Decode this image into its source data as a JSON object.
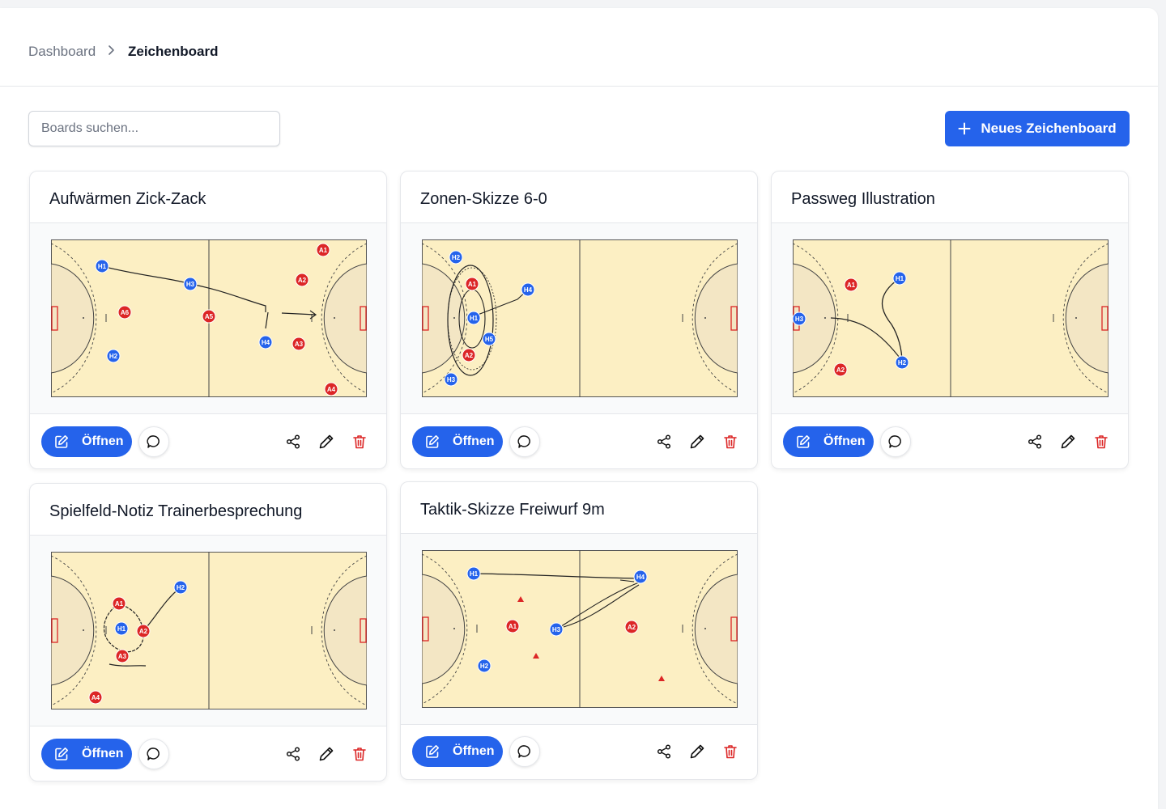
{
  "breadcrumb": {
    "home": "Dashboard",
    "current": "Zeichenboard"
  },
  "search": {
    "placeholder": "Boards suchen..."
  },
  "toolbar": {
    "new_board_label": "Neues Zeichenboard"
  },
  "colors": {
    "accent": "#2563eb",
    "danger": "#dc2626",
    "court": "#fcefc3",
    "team_h": "#2563eb",
    "team_a": "#dc2626"
  },
  "card_actions": {
    "open_label": "Öffnen",
    "comment_icon": "chat-bubble-icon",
    "share_icon": "share-icon",
    "edit_icon": "pencil-icon",
    "delete_icon": "trash-icon"
  },
  "boards": [
    {
      "title": "Aufwärmen Zick-Zack",
      "players": [
        "H1",
        "H2",
        "H3",
        "H4",
        "A1",
        "A2",
        "A3",
        "A4",
        "A5",
        "A6"
      ]
    },
    {
      "title": "Zonen-Skizze 6-0",
      "players": [
        "H1",
        "H2",
        "H3",
        "H4",
        "H5",
        "A1",
        "A2"
      ]
    },
    {
      "title": "Passweg Illustration",
      "players": [
        "H1",
        "H2",
        "H3",
        "A1",
        "A2"
      ]
    },
    {
      "title": "Spielfeld-Notiz Trainerbesprechung",
      "players": [
        "H1",
        "H2",
        "A1",
        "A2",
        "A3",
        "A4"
      ]
    },
    {
      "title": "Taktik-Skizze Freiwurf 9m",
      "players": [
        "H1",
        "H2",
        "H3",
        "H4",
        "A1",
        "A2"
      ]
    }
  ]
}
